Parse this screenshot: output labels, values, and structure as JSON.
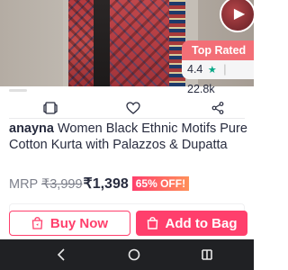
{
  "hero": {
    "play_glyph": "▶",
    "badge_label": "Top Rated",
    "rating_value": "4.4",
    "rating_star": "★",
    "rating_separator": "|",
    "rating_count": "22.8k"
  },
  "actions": {
    "icons": [
      "compare-icon",
      "heart-icon",
      "share-icon"
    ]
  },
  "product": {
    "brand": "anayna",
    "name": " Women Black Ethnic Motifs Pure Cotton Kurta with Palazzos & Dupatta",
    "mrp_label": "MRP ",
    "mrp_value": "₹3,999",
    "price": "₹1,398",
    "discount": "65% OFF!"
  },
  "buttons": {
    "buy_now": "Buy Now",
    "add_to_bag": "Add to Bag"
  },
  "colors": {
    "accent": "#ff3f6c",
    "badge": "#f36f77",
    "rating_star": "#03a685",
    "navbar": "#202124"
  },
  "navbar": {
    "items": [
      "back-icon",
      "home-icon",
      "recents-icon"
    ]
  }
}
